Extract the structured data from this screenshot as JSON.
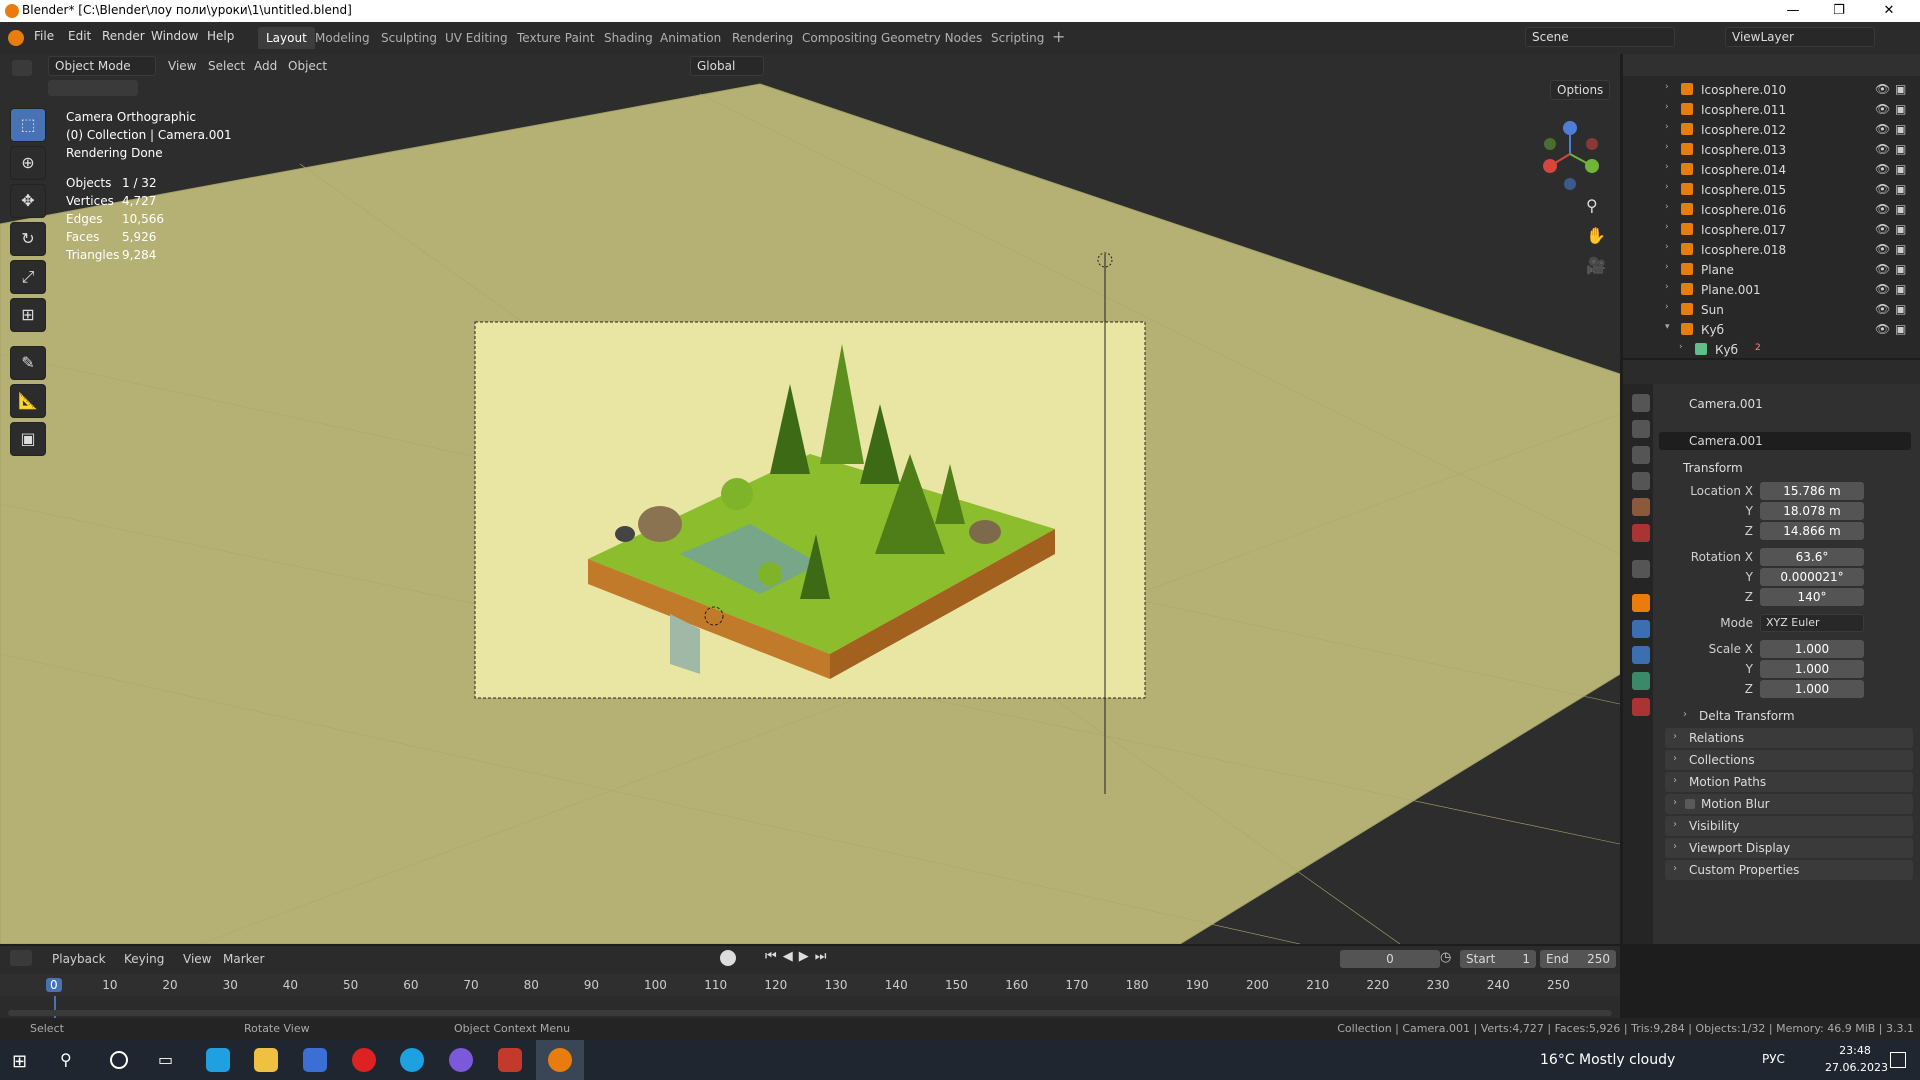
{
  "window": {
    "title": "Blender* [C:\\Blender\\лоу поли\\уроки\\1\\untitled.blend]",
    "min": "—",
    "max": "❐",
    "close": "✕"
  },
  "menu": {
    "file": "File",
    "edit": "Edit",
    "render": "Render",
    "window": "Window",
    "help": "Help"
  },
  "workspaces": [
    "Layout",
    "Modeling",
    "Sculpting",
    "UV Editing",
    "Texture Paint",
    "Shading",
    "Animation",
    "Rendering",
    "Compositing",
    "Geometry Nodes",
    "Scripting"
  ],
  "scene": {
    "name": "Scene",
    "view_layer": "ViewLayer"
  },
  "viewport": {
    "mode": "Object Mode",
    "view": "View",
    "select": "Select",
    "add": "Add",
    "object": "Object",
    "orientation": "Global",
    "options": "Options",
    "camera_label": "Camera Orthographic",
    "collection_label": "(0) Collection | Camera.001",
    "render_status": "Rendering Done",
    "stats": [
      {
        "label": "Objects",
        "value": "1 / 32"
      },
      {
        "label": "Vertices",
        "value": "4,727"
      },
      {
        "label": "Edges",
        "value": "10,566"
      },
      {
        "label": "Faces",
        "value": "5,926"
      },
      {
        "label": "Triangles",
        "value": "9,284"
      }
    ]
  },
  "outliner": {
    "items": [
      {
        "name": "Icosphere.010",
        "type": "mesh"
      },
      {
        "name": "Icosphere.011",
        "type": "mesh"
      },
      {
        "name": "Icosphere.012",
        "type": "mesh"
      },
      {
        "name": "Icosphere.013",
        "type": "mesh"
      },
      {
        "name": "Icosphere.014",
        "type": "mesh"
      },
      {
        "name": "Icosphere.015",
        "type": "mesh"
      },
      {
        "name": "Icosphere.016",
        "type": "mesh"
      },
      {
        "name": "Icosphere.017",
        "type": "mesh"
      },
      {
        "name": "Icosphere.018",
        "type": "mesh"
      },
      {
        "name": "Plane",
        "type": "mesh"
      },
      {
        "name": "Plane.001",
        "type": "mesh"
      },
      {
        "name": "Sun",
        "type": "light"
      },
      {
        "name": "Куб",
        "type": "mesh"
      },
      {
        "name": "Куб",
        "type": "meshdata",
        "badge": "2"
      }
    ]
  },
  "properties": {
    "object_name": "Camera.001",
    "object_field": "Camera.001",
    "transform_label": "Transform",
    "location_label": "Location X",
    "location": {
      "x": "15.786 m",
      "y": "18.078 m",
      "z": "14.866 m"
    },
    "rotation_label": "Rotation X",
    "rotation": {
      "x": "63.6°",
      "y": "0.000021°",
      "z": "140°"
    },
    "mode_label": "Mode",
    "mode_value": "XYZ Euler",
    "scale_label": "Scale X",
    "scale": {
      "x": "1.000",
      "y": "1.000",
      "z": "1.000"
    },
    "axis_y": "Y",
    "axis_z": "Z",
    "panels": [
      "Delta Transform",
      "Relations",
      "Collections",
      "Motion Paths",
      "Motion Blur",
      "Visibility",
      "Viewport Display",
      "Custom Properties"
    ]
  },
  "timeline": {
    "playback": "Playback",
    "keying": "Keying",
    "view": "View",
    "marker": "Marker",
    "current_frame": "0",
    "start_label": "Start",
    "start": "1",
    "end_label": "End",
    "end": "250",
    "ticks": [
      "0",
      "10",
      "20",
      "30",
      "40",
      "50",
      "60",
      "70",
      "80",
      "90",
      "100",
      "110",
      "120",
      "130",
      "140",
      "150",
      "160",
      "170",
      "180",
      "190",
      "200",
      "210",
      "220",
      "230",
      "240",
      "250"
    ]
  },
  "status": {
    "select": "Select",
    "rotate": "Rotate View",
    "context": "Object Context Menu",
    "info": "Collection | Camera.001 | Verts:4,727 | Faces:5,926 | Tris:9,284 | Objects:1/32 | Memory: 46.9 MiB | 3.3.1"
  },
  "taskbar": {
    "weather": "16°C  Mostly cloudy",
    "lang": "РУС",
    "time": "23:48",
    "date": "27.06.2023"
  },
  "colors": {
    "accent": "#4772b3",
    "active_orange": "#e87d0d",
    "ground": "#b5b073",
    "camera_frame": "#e8e6a6",
    "grass": "#8bbd2d"
  }
}
